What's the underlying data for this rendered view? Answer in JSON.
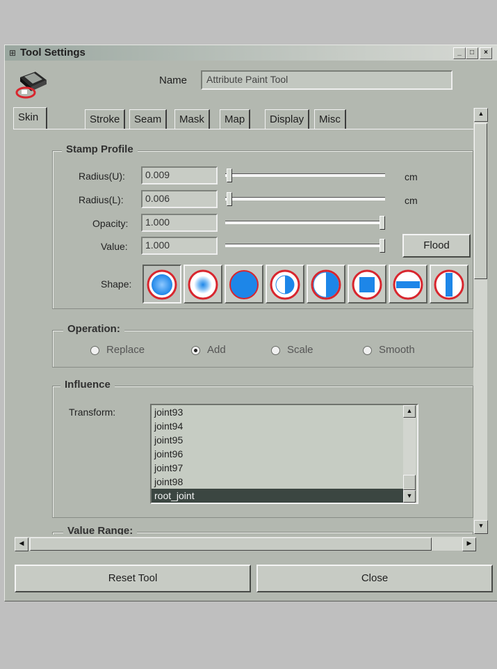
{
  "window": {
    "title": "Tool Settings",
    "title_icon": "⊞",
    "controls": [
      "_",
      "□",
      "×"
    ]
  },
  "header": {
    "name_label": "Name",
    "name_value": "Attribute Paint Tool",
    "tool_icon": "paint-brush-tool-icon"
  },
  "tabs": [
    "Skin Paint",
    "Stroke",
    "Seam",
    "Mask",
    "Map",
    "Display",
    "Misc"
  ],
  "stamp_profile": {
    "legend": "Stamp Profile",
    "radius_u": {
      "label": "Radius(U):",
      "value": "0.009",
      "unit": "cm",
      "slider_fraction": 0.02
    },
    "radius_l": {
      "label": "Radius(L):",
      "value": "0.006",
      "unit": "cm",
      "slider_fraction": 0.01
    },
    "opacity": {
      "label": "Opacity:",
      "value": "1.000",
      "slider_fraction": 1.0
    },
    "value": {
      "label": "Value:",
      "value": "1.000",
      "slider_fraction": 1.0
    },
    "flood_label": "Flood",
    "shape_label": "Shape:",
    "shapes": [
      "gaussian-brush",
      "soft-brush",
      "solid-circle-brush",
      "half-right-brush",
      "half-left-brush",
      "square-brush",
      "horizontal-bar-brush",
      "vertical-bar-brush"
    ],
    "selected_shape": 0
  },
  "operation": {
    "legend": "Operation:",
    "options": [
      "Replace",
      "Add",
      "Scale",
      "Smooth"
    ],
    "selected": 1
  },
  "influence": {
    "legend": "Influence",
    "transform_label": "Transform:",
    "items": [
      "joint93",
      "joint94",
      "joint95",
      "joint96",
      "joint97",
      "joint98",
      "root_joint"
    ],
    "selected": "root_joint"
  },
  "value_range": {
    "legend": "Value Range:"
  },
  "footer": {
    "reset_label": "Reset Tool",
    "close_label": "Close"
  },
  "colors": {
    "brush_blue": "#1d86e8",
    "brush_ring": "#d8262e",
    "window_bg": "#b3b8b0"
  }
}
